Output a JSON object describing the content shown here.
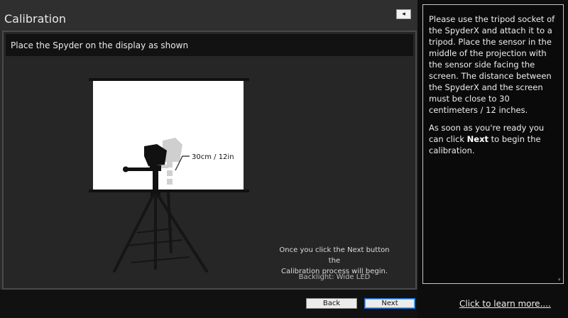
{
  "window": {
    "title": "Calibration",
    "pin_icon": "pin-icon",
    "pin_glyph": "◂"
  },
  "content": {
    "instruction": "Place the Spyder on the display as shown",
    "distance_label": "30cm / 12in",
    "info_line1": "Once you click the Next button the",
    "info_line2": "Calibration process will begin.",
    "backlight": "Backlight: Wide LED"
  },
  "buttons": {
    "back": "Back",
    "next": "Next"
  },
  "sidebar": {
    "para1": "Please use the tripod socket of the SpyderX and attach it to a tripod. Place the sensor in the middle of the projection with the sensor side facing the screen. The distance between the SpyderX and the screen must be close to 30 centimeters / 12 inches.",
    "para2_a": "As soon as you're ready you can click ",
    "para2_bold": "Next",
    "para2_b": " to begin the calibration.",
    "learn_more": "Click to learn more...."
  },
  "colors": {
    "accent": "#1f6fd1",
    "background": "#2b2b2b",
    "sidebar": "#0d0d0d"
  }
}
